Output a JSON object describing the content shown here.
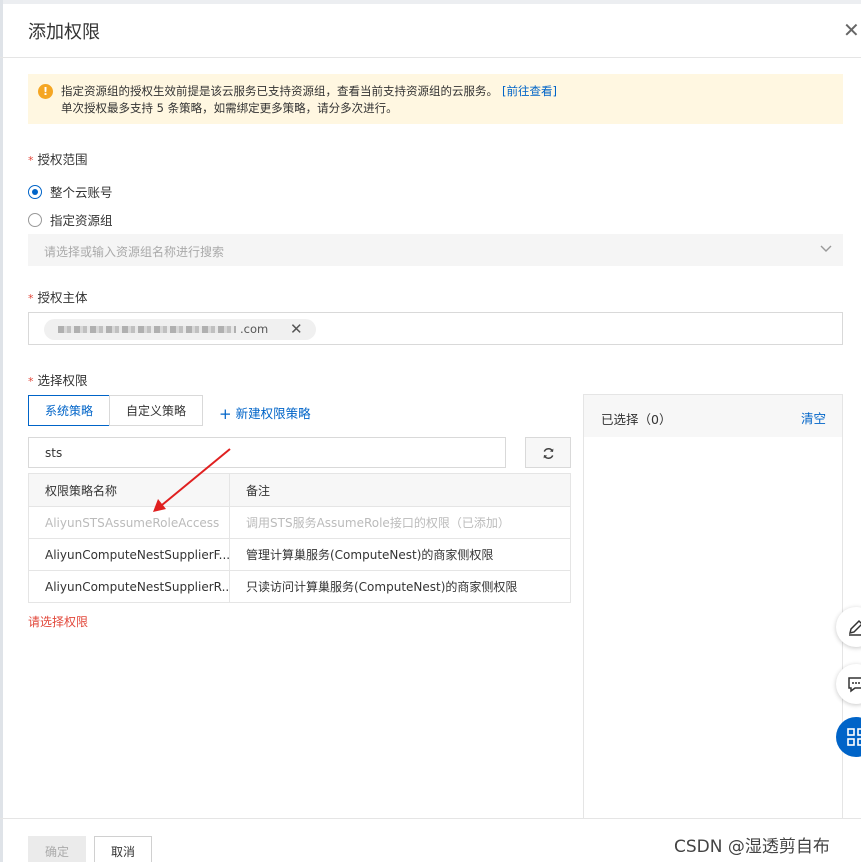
{
  "dialog": {
    "title": "添加权限",
    "close_icon": "✕"
  },
  "alert": {
    "icon": "!",
    "line1": "指定资源组的授权生效前提是该云服务已支持资源组，查看当前支持资源组的云服务。",
    "link": "[前往查看]",
    "line2": "单次授权最多支持 5 条策略，如需绑定更多策略，请分多次进行。"
  },
  "required_mark": "*",
  "scope": {
    "label": "授权范围",
    "options": [
      {
        "label": "整个云账号",
        "checked": true
      },
      {
        "label": "指定资源组",
        "checked": false
      }
    ],
    "select_placeholder": "请选择或输入资源组名称进行搜索"
  },
  "subject": {
    "label": "授权主体",
    "tag_suffix": ".com",
    "tag_remove_icon": "✕"
  },
  "permissions": {
    "label": "选择权限",
    "tabs": [
      {
        "label": "系统策略",
        "active": true
      },
      {
        "label": "自定义策略",
        "active": false
      }
    ],
    "new_policy": "新建权限策略",
    "search_value": "sts",
    "table": {
      "headers": [
        "权限策略名称",
        "备注"
      ],
      "rows": [
        {
          "name": "AliyunSTSAssumeRoleAccess",
          "note": "调用STS服务AssumeRole接口的权限（已添加）",
          "disabled": true
        },
        {
          "name": "AliyunComputeNestSupplierF...",
          "note": "管理计算巢服务(ComputeNest)的商家侧权限",
          "disabled": false
        },
        {
          "name": "AliyunComputeNestSupplierR...",
          "note": "只读访问计算巢服务(ComputeNest)的商家侧权限",
          "disabled": false
        }
      ]
    },
    "error": "请选择权限"
  },
  "selected_panel": {
    "title": "已选择（0）",
    "clear": "清空"
  },
  "footer": {
    "ok": "确定",
    "cancel": "取消"
  },
  "watermark": "CSDN @湿透剪自布",
  "colors": {
    "primary": "#0064c8",
    "danger": "#e2473a",
    "warning_bg": "#fff7e1",
    "warning_icon": "#f5a623",
    "annotation": "#e02020"
  },
  "icons": [
    "close-icon",
    "warning-icon",
    "chevron-down-icon",
    "refresh-icon",
    "plus-icon",
    "edit-icon",
    "feedback-icon",
    "apps-icon"
  ]
}
